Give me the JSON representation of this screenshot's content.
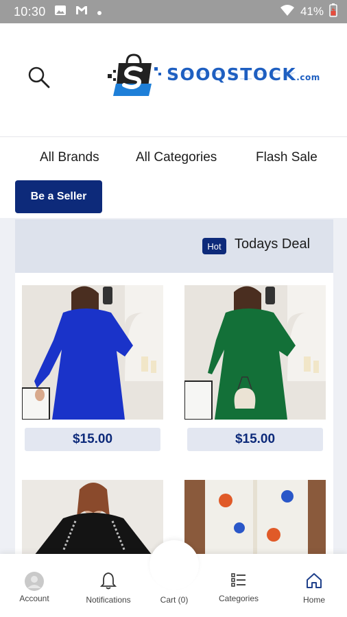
{
  "status_bar": {
    "time": "10:30",
    "battery": "41%"
  },
  "header": {
    "logo_text": "SOOQSTOCK",
    "logo_suffix": ".com"
  },
  "nav": {
    "links": [
      "All Brands",
      "All Categories",
      "Flash Sale"
    ],
    "seller_button": "Be a Seller"
  },
  "deal": {
    "badge": "Hot",
    "title": "Todays Deal",
    "products": [
      {
        "price": "$15.00",
        "dress_color": "#1a33c9"
      },
      {
        "price": "$15.00",
        "dress_color": "#137038"
      },
      {
        "price": "",
        "dress_color": "#141414"
      },
      {
        "price": "",
        "dress_color": "#f1efe9"
      }
    ]
  },
  "bottom_nav": {
    "items": [
      {
        "label": "Account",
        "icon": "account-icon"
      },
      {
        "label": "Notifications",
        "icon": "bell-icon"
      },
      {
        "label": "Cart (0)",
        "icon": "cart-icon"
      },
      {
        "label": "Categories",
        "icon": "list-icon"
      },
      {
        "label": "Home",
        "icon": "home-icon"
      }
    ]
  },
  "colors": {
    "brand": "#0d2a7a",
    "logo_blue": "#1e5fc1",
    "status_bar": "#9c9c9c"
  }
}
